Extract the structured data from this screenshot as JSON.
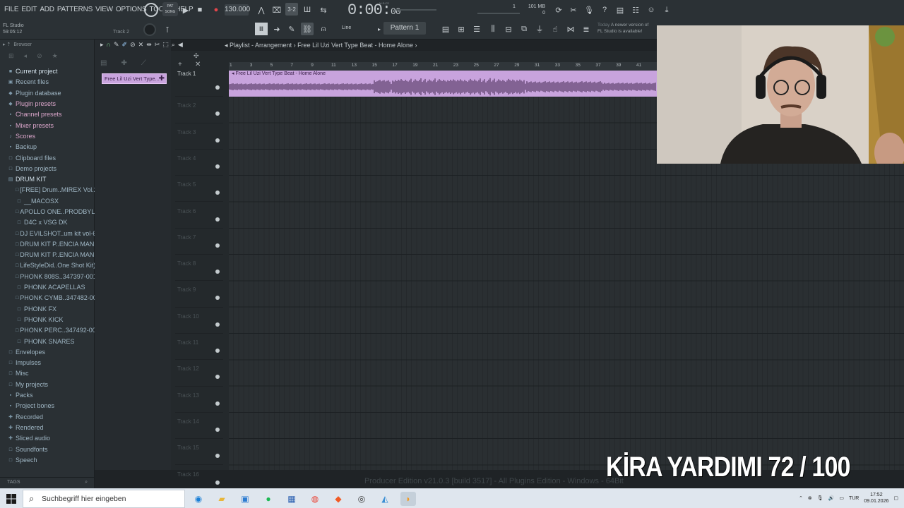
{
  "menu": [
    "FILE",
    "EDIT",
    "ADD",
    "PATTERNS",
    "VIEW",
    "OPTIONS",
    "TOOLS",
    "HELP"
  ],
  "project": {
    "name": "FL Studio",
    "time": "59:05:12",
    "track_hint": "Track 2"
  },
  "transport": {
    "pat_song": "PAT\nSONG",
    "tempo": "130.000",
    "time_main": "0:00:",
    "time_small": "00",
    "time_label": "M:S:CS"
  },
  "status": {
    "cpu": "1",
    "mem": "101 MB",
    "voices": "0"
  },
  "news": {
    "line1_prefix": "Today",
    "line1": "A newer version of",
    "line2": "FL Studio is available!"
  },
  "snap": {
    "label": "Line"
  },
  "pattern": {
    "label": "Pattern 1"
  },
  "browser": {
    "title": "Browser",
    "items": [
      {
        "label": "Current project",
        "icon": "■",
        "sub": false,
        "style": "sel"
      },
      {
        "label": "Recent files",
        "icon": "▣",
        "sub": false,
        "style": ""
      },
      {
        "label": "Plugin database",
        "icon": "◆",
        "sub": false,
        "style": ""
      },
      {
        "label": "Plugin presets",
        "icon": "◆",
        "sub": false,
        "style": "pink"
      },
      {
        "label": "Channel presets",
        "icon": "▪",
        "sub": false,
        "style": "pink"
      },
      {
        "label": "Mixer presets",
        "icon": "▪",
        "sub": false,
        "style": "pink"
      },
      {
        "label": "Scores",
        "icon": "♪",
        "sub": false,
        "style": "pink"
      },
      {
        "label": "Backup",
        "icon": "▪",
        "sub": false,
        "style": ""
      },
      {
        "label": "Clipboard files",
        "icon": "□",
        "sub": false,
        "style": ""
      },
      {
        "label": "Demo projects",
        "icon": "□",
        "sub": false,
        "style": ""
      },
      {
        "label": "DRUM KIT",
        "icon": "▤",
        "sub": false,
        "style": "sel"
      },
      {
        "label": "[FREE] Drum..MIREX Vol.2",
        "icon": "□",
        "sub": true,
        "style": ""
      },
      {
        "label": "__MACOSX",
        "icon": "□",
        "sub": true,
        "style": ""
      },
      {
        "label": "APOLLO ONE..PRODBYLJS",
        "icon": "□",
        "sub": true,
        "style": ""
      },
      {
        "label": "D4C x VSG DK",
        "icon": "□",
        "sub": true,
        "style": ""
      },
      {
        "label": "DJ EVILSHOT..um kit vol-6",
        "icon": "□",
        "sub": true,
        "style": ""
      },
      {
        "label": "DRUM KIT P..ENCIA MANE",
        "icon": "□",
        "sub": true,
        "style": ""
      },
      {
        "label": "DRUM KIT P..ENCIA MANE",
        "icon": "□",
        "sub": true,
        "style": ""
      },
      {
        "label": "LifeStyleDid..One Shot Kit)",
        "icon": "□",
        "sub": true,
        "style": ""
      },
      {
        "label": "PHONK 808S..347397-001",
        "icon": "□",
        "sub": true,
        "style": ""
      },
      {
        "label": "PHONK ACAPELLAS",
        "icon": "□",
        "sub": true,
        "style": ""
      },
      {
        "label": "PHONK CYMB..347482-001",
        "icon": "□",
        "sub": true,
        "style": ""
      },
      {
        "label": "PHONK FX",
        "icon": "□",
        "sub": true,
        "style": ""
      },
      {
        "label": "PHONK KICK",
        "icon": "□",
        "sub": true,
        "style": ""
      },
      {
        "label": "PHONK PERC..347492-001",
        "icon": "□",
        "sub": true,
        "style": ""
      },
      {
        "label": "PHONK SNARES",
        "icon": "□",
        "sub": true,
        "style": ""
      },
      {
        "label": "Envelopes",
        "icon": "□",
        "sub": false,
        "style": ""
      },
      {
        "label": "Impulses",
        "icon": "□",
        "sub": false,
        "style": ""
      },
      {
        "label": "Misc",
        "icon": "□",
        "sub": false,
        "style": ""
      },
      {
        "label": "My projects",
        "icon": "□",
        "sub": false,
        "style": ""
      },
      {
        "label": "Packs",
        "icon": "▪",
        "sub": false,
        "style": ""
      },
      {
        "label": "Project bones",
        "icon": "▪",
        "sub": false,
        "style": ""
      },
      {
        "label": "Recorded",
        "icon": "✚",
        "sub": false,
        "style": ""
      },
      {
        "label": "Rendered",
        "icon": "✚",
        "sub": false,
        "style": ""
      },
      {
        "label": "Sliced audio",
        "icon": "✚",
        "sub": false,
        "style": ""
      },
      {
        "label": "Soundfonts",
        "icon": "□",
        "sub": false,
        "style": ""
      },
      {
        "label": "Speech",
        "icon": "□",
        "sub": false,
        "style": ""
      }
    ],
    "footer": "TAGS"
  },
  "picker": {
    "clip": "Free Lil Uzi Vert Type..."
  },
  "playlist": {
    "breadcrumb": "Playlist - Arrangement › Free Lil Uzi Vert Type Beat - Home Alone ›",
    "ruler": [
      "1",
      "3",
      "5",
      "7",
      "9",
      "11",
      "13",
      "15",
      "17",
      "19",
      "21",
      "23",
      "25",
      "27",
      "29",
      "31",
      "33",
      "35",
      "37",
      "39",
      "41"
    ],
    "tracks": [
      "Track 1",
      "Track 2",
      "Track 3",
      "Track 4",
      "Track 5",
      "Track 6",
      "Track 7",
      "Track 8",
      "Track 9",
      "Track 10",
      "Track 11",
      "Track 12",
      "Track 13",
      "Track 14",
      "Track 15",
      "Track 16"
    ],
    "clip_label": "Free Lil Uzi Vert Type Beat - Home Alone"
  },
  "watermark": "Producer Edition v21.0.3 [build 3517] - All Plugins Edition - Windows - 64Bit",
  "overlay": "KİRA YARDIMI  72 / 100",
  "taskbar": {
    "search_placeholder": "Suchbegriff hier eingeben",
    "lang": "TUR",
    "time": "17:52",
    "date": "09.01.2026"
  },
  "colors": {
    "clip": "#c8a3dd",
    "accent": "#7dd88f"
  }
}
